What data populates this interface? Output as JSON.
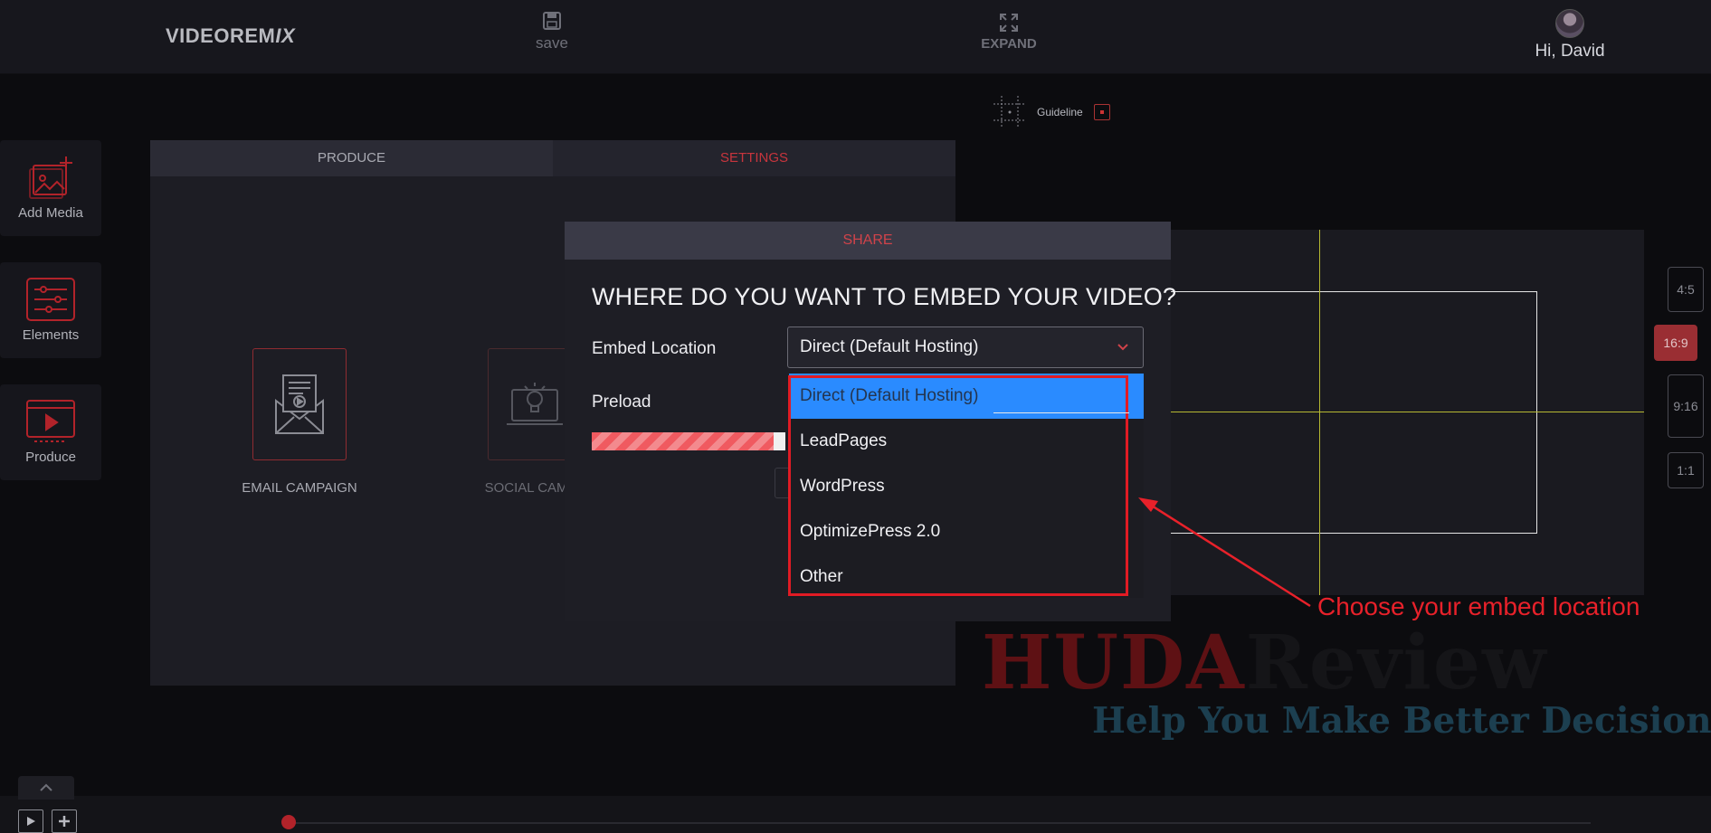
{
  "app": {
    "logo_main": "VIDEOREM",
    "logo_tail": "IX"
  },
  "toolbar": {
    "save_label": "save",
    "expand_label": "EXPAND",
    "greeting": "Hi, David"
  },
  "guideline": {
    "label": "Guideline"
  },
  "sidebar": {
    "items": [
      {
        "label": "Add Media",
        "icon": "add-media-icon"
      },
      {
        "label": "Elements",
        "icon": "sliders-icon"
      },
      {
        "label": "Produce",
        "icon": "play-screen-icon"
      }
    ]
  },
  "panel": {
    "tabs": [
      {
        "label": "PRODUCE"
      },
      {
        "label": "SETTINGS"
      }
    ],
    "campaigns": [
      {
        "label": "EMAIL CAMPAIGN",
        "icon": "email-video-icon"
      },
      {
        "label": "SOCIAL CAMPA",
        "icon": "laptop-bulb-icon"
      }
    ]
  },
  "ratios": [
    {
      "label": "4:5"
    },
    {
      "label": "16:9"
    },
    {
      "label": "9:16"
    },
    {
      "label": "1:1"
    }
  ],
  "dialog": {
    "title": "SHARE",
    "question": "WHERE DO YOU WANT TO EMBED YOUR VIDEO?",
    "embed_label": "Embed Location",
    "embed_value": "Direct (Default Hosting)",
    "preload_label": "Preload",
    "options": [
      {
        "label": "Direct (Default Hosting)"
      },
      {
        "label": "LeadPages"
      },
      {
        "label": "WordPress"
      },
      {
        "label": "OptimizePress 2.0"
      },
      {
        "label": "Other"
      }
    ]
  },
  "annotation": {
    "text": "Choose your embed location",
    "color": "#e8212a"
  },
  "watermark": {
    "title_a": "HUDA",
    "title_b": "Review",
    "subtitle": "Help You Make Better Decisions"
  },
  "colors": {
    "accent": "#c8353d",
    "selected_option": "#2a8bff",
    "guide_line": "#b6b832"
  }
}
